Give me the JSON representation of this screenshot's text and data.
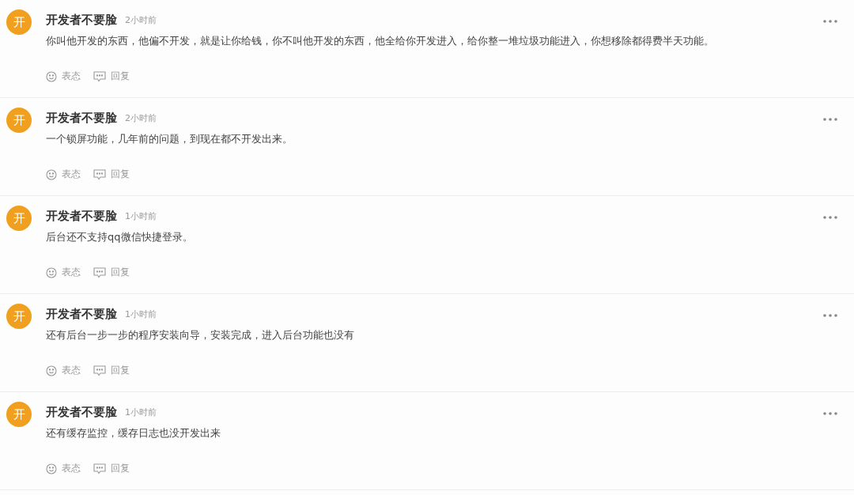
{
  "comments": [
    {
      "avatar": "开",
      "author": "开发者不要脸",
      "time": "2小时前",
      "content": "你叫他开发的东西，他偏不开发，就是让你给钱，你不叫他开发的东西，他全给你开发进入，给你整一堆垃圾功能进入，你想移除都得费半天功能。",
      "actions": [
        "表态",
        "回复"
      ]
    },
    {
      "avatar": "开",
      "author": "开发者不要脸",
      "time": "2小时前",
      "content": "一个锁屏功能，几年前的问题，到现在都不开发出来。",
      "actions": [
        "表态",
        "回复"
      ]
    },
    {
      "avatar": "开",
      "author": "开发者不要脸",
      "time": "1小时前",
      "content": "后台还不支持qq微信快捷登录。",
      "actions": [
        "表态",
        "回复"
      ]
    },
    {
      "avatar": "开",
      "author": "开发者不要脸",
      "time": "1小时前",
      "content": "还有后台一步一步的程序安装向导，安装完成，进入后台功能也没有",
      "actions": [
        "表态",
        "回复"
      ]
    },
    {
      "avatar": "开",
      "author": "开发者不要脸",
      "time": "1小时前",
      "content": "还有缓存监控，缓存日志也没开发出来",
      "actions": [
        "表态",
        "回复"
      ]
    }
  ]
}
